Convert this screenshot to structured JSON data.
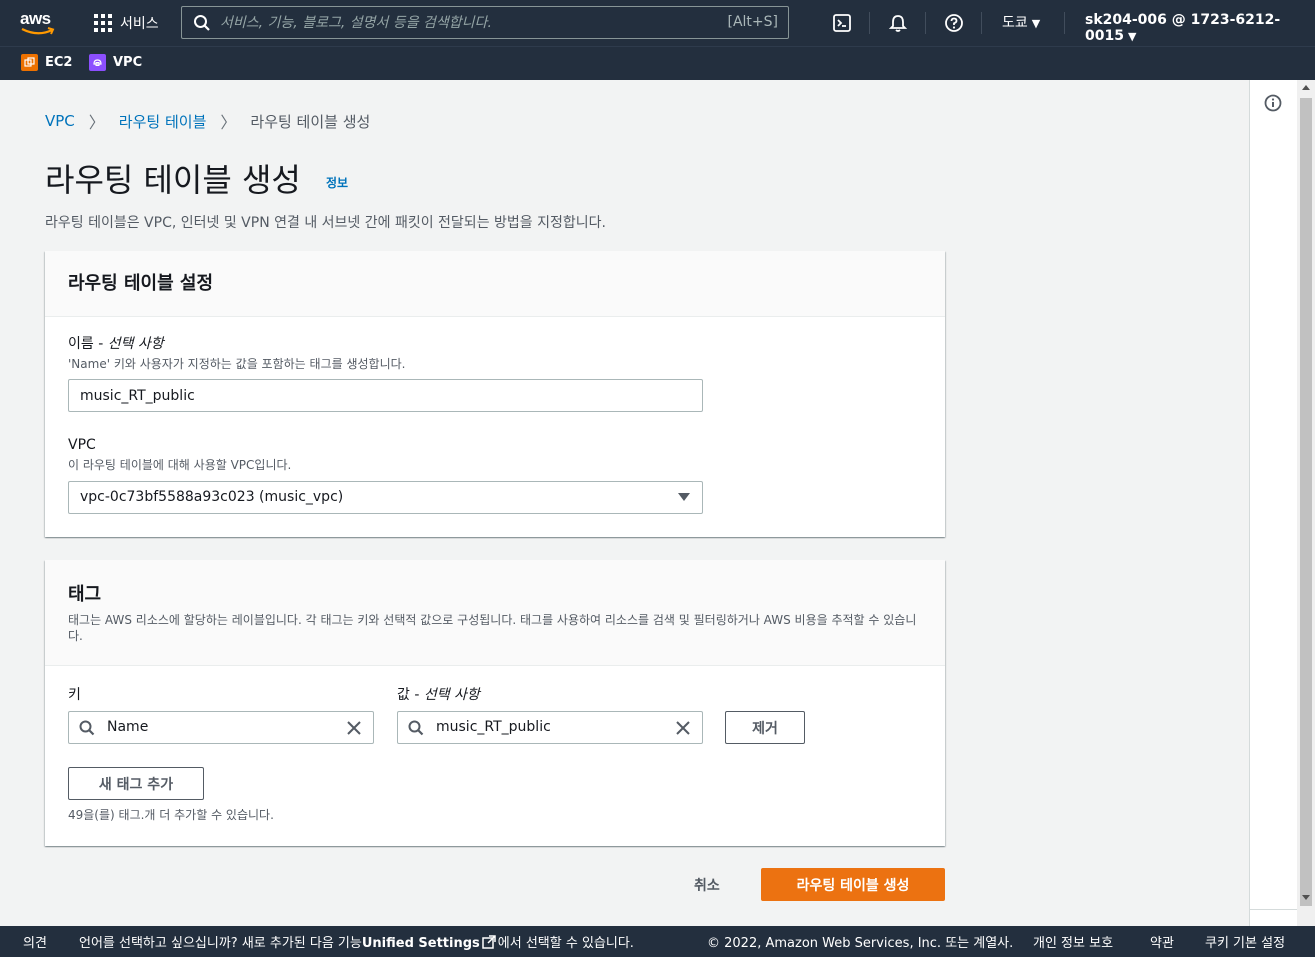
{
  "topnav": {
    "logo_text": "aws",
    "services_label": "서비스",
    "search_placeholder": "서비스, 기능, 블로그, 설명서 등을 검색합니다.",
    "search_shortcut": "[Alt+S]",
    "region": "도쿄",
    "account": "sk204-006 @ 1723-6212-0015"
  },
  "favorites": [
    {
      "label": "EC2",
      "color": "#ed7100"
    },
    {
      "label": "VPC",
      "color": "#8c4fff"
    }
  ],
  "breadcrumb": {
    "items": [
      "VPC",
      "라우팅 테이블"
    ],
    "current": "라우팅 테이블 생성"
  },
  "page": {
    "title": "라우팅 테이블 생성",
    "info": "정보",
    "description": "라우팅 테이블은 VPC, 인터넷 및 VPN 연결 내 서브넷 간에 패킷이 전달되는 방법을 지정합니다."
  },
  "settings_panel": {
    "title": "라우팅 테이블 설정",
    "name_label": "이름",
    "name_optional": "선택 사항",
    "name_desc": "'Name' 키와 사용자가 지정하는 값을 포함하는 태그를 생성합니다.",
    "name_value": "music_RT_public",
    "vpc_label": "VPC",
    "vpc_desc": "이 라우팅 테이블에 대해 사용할 VPC입니다.",
    "vpc_value": "vpc-0c73bf5588a93c023 (music_vpc)"
  },
  "tags_panel": {
    "title": "태그",
    "description": "태그는 AWS 리소스에 할당하는 레이블입니다. 각 태그는 키와 선택적 값으로 구성됩니다. 태그를 사용하여 리소스를 검색 및 필터링하거나 AWS 비용을 추적할 수 있습니다.",
    "key_label": "키",
    "value_label": "값",
    "value_optional": "선택 사항",
    "key_value": "Name",
    "value_value": "music_RT_public",
    "remove_button": "제거",
    "add_button": "새 태그 추가",
    "remaining": "49을(를) 태그.개 더 추가할 수 있습니다."
  },
  "actions": {
    "cancel": "취소",
    "create": "라우팅 테이블 생성"
  },
  "footer": {
    "feedback": "의견",
    "lang_text_1": "언어를 선택하고 싶으십니까? 새로 추가된 다음 기능",
    "unified_settings": "Unified Settings",
    "lang_text_2": "에서 선택할 수 있습니다.",
    "copyright": "© 2022, Amazon Web Services, Inc. 또는 계열사.",
    "privacy": "개인 정보 보호",
    "terms": "약관",
    "cookies": "쿠키 기본 설정"
  }
}
